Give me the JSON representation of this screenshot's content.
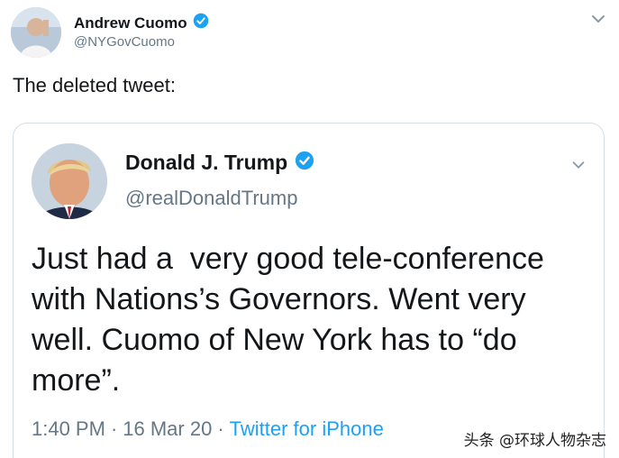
{
  "outer_tweet": {
    "name": "Andrew Cuomo",
    "handle": "@NYGovCuomo",
    "caption": "The deleted tweet:"
  },
  "quoted_tweet": {
    "name": "Donald J. Trump",
    "handle": "@realDonaldTrump",
    "text": "Just had a  very good tele-conference\nwith Nations’s Governors. Went very\nwell. Cuomo of New York has to “do\nmore”.",
    "time": "1:40 PM",
    "date": "16 Mar 20",
    "source": "Twitter for iPhone",
    "separator": "·"
  },
  "watermark": "头条 @环球人物杂志",
  "colors": {
    "verified": "#1da1f2",
    "muted": "#657786",
    "link": "#1da1f2",
    "border": "#d5dde4"
  }
}
